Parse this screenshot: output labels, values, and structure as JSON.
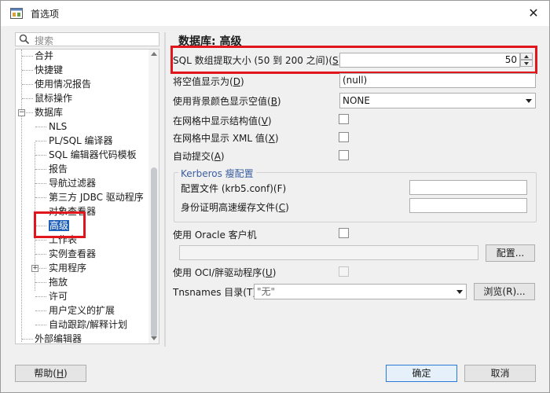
{
  "window": {
    "title": "首选项"
  },
  "search": {
    "placeholder": "搜索"
  },
  "tree": {
    "items": [
      {
        "label": "合并",
        "level": 1
      },
      {
        "label": "快捷键",
        "level": 1
      },
      {
        "label": "使用情况报告",
        "level": 1
      },
      {
        "label": "鼠标操作",
        "level": 1
      },
      {
        "label": "数据库",
        "level": 1,
        "expanded": true
      },
      {
        "label": "NLS",
        "level": 2
      },
      {
        "label": "PL/SQL 编译器",
        "level": 2
      },
      {
        "label": "SQL 编辑器代码模板",
        "level": 2
      },
      {
        "label": "报告",
        "level": 2
      },
      {
        "label": "导航过滤器",
        "level": 2
      },
      {
        "label": "第三方 JDBC 驱动程序",
        "level": 2
      },
      {
        "label": "对象查看器",
        "level": 2
      },
      {
        "label": "高级",
        "level": 2,
        "selected": true
      },
      {
        "label": "工作表",
        "level": 2
      },
      {
        "label": "实例查看器",
        "level": 2
      },
      {
        "label": "实用程序",
        "level": 2,
        "collapsed": true
      },
      {
        "label": "拖放",
        "level": 2
      },
      {
        "label": "许可",
        "level": 2
      },
      {
        "label": "用户定义的扩展",
        "level": 2
      },
      {
        "label": "自动跟踪/解释计划",
        "level": 2
      },
      {
        "label": "外部编辑器",
        "level": 1
      }
    ]
  },
  "panel": {
    "title": "数据库: 高级",
    "fetch_size_label": "SQL 数组提取大小 (50 到 200 之间)(",
    "fetch_size_key": "S",
    "fetch_size_value": "50",
    "null_display_label": "将空值显示为(",
    "null_display_key": "D",
    "null_display_value": "(null)",
    "bg_null_label": "使用背景颜色显示空值(",
    "bg_null_key": "B",
    "bg_null_value": "NONE",
    "struct_grid_label": "在网格中显示结构值(",
    "struct_grid_key": "V",
    "xml_grid_label": "在网格中显示 XML 值(",
    "xml_grid_key": "X",
    "autocommit_label": "自动提交(",
    "autocommit_key": "A",
    "kerberos_title": "Kerberos 瘦配置",
    "kerberos_config_label": "配置文件 (krb5.conf)(F)",
    "kerberos_cache_label": "身份证明高速缓存文件(",
    "kerberos_cache_key": "C",
    "oracle_client_label": "使用 Oracle 客户机",
    "config_button": "配置...",
    "oci_label": "使用 OCI/胖驱动程序(",
    "oci_key": "U",
    "tnsnames_label": "Tnsnames 目录(T)",
    "tnsnames_value": "\"无\"",
    "browse_button": "浏览(R)..."
  },
  "footer": {
    "help_label": "帮助(",
    "help_key": "H",
    "ok_label": "确定",
    "cancel_label": "取消"
  }
}
